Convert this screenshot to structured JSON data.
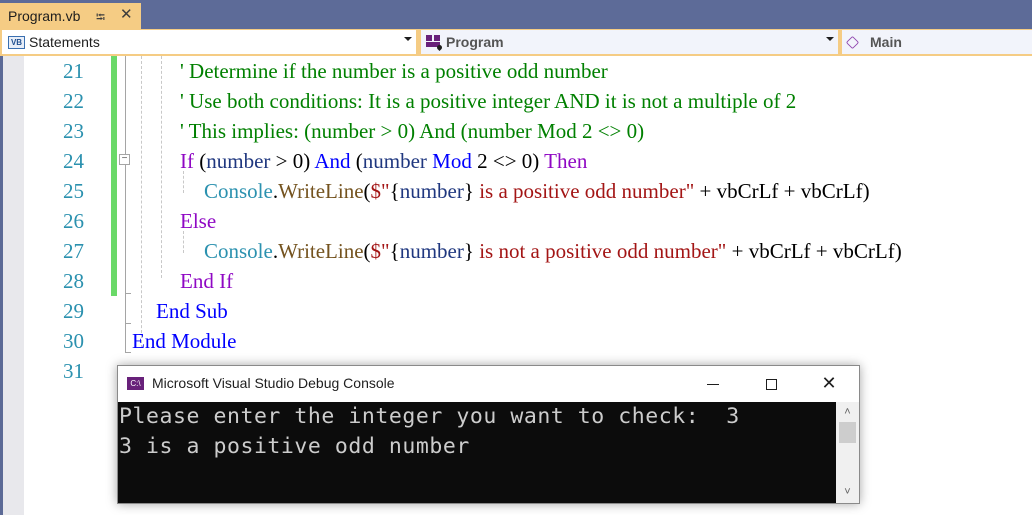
{
  "tab": {
    "title": "Program.vb",
    "pin_icon": "pin-icon",
    "close_icon": "close-icon"
  },
  "navbar": {
    "project_combo": {
      "icon": "vb-project-icon",
      "icon_text": "VB",
      "value": "Statements"
    },
    "type_combo": {
      "icon": "module-icon",
      "value": "Program"
    },
    "member_combo": {
      "icon": "method-icon",
      "value": "Main"
    }
  },
  "editor": {
    "line_numbers": [
      "21",
      "22",
      "23",
      "24",
      "25",
      "26",
      "27",
      "28",
      "29",
      "30",
      "31"
    ],
    "lines": [
      {
        "number": "21",
        "tokens": [
          {
            "t": "cm",
            "v": "' Determine if the number is a positive odd number"
          }
        ]
      },
      {
        "number": "22",
        "tokens": [
          {
            "t": "cm",
            "v": "' Use both conditions: It is a positive integer AND it is not a multiple of 2"
          }
        ]
      },
      {
        "number": "23",
        "tokens": [
          {
            "t": "cm",
            "v": "' This implies: (number > 0) And (number Mod 2 <> 0)"
          }
        ]
      },
      {
        "number": "24",
        "tokens": [
          {
            "t": "ctl",
            "v": "If"
          },
          {
            "t": "pl",
            "v": " ("
          },
          {
            "t": "id",
            "v": "number"
          },
          {
            "t": "pl",
            "v": " > 0) "
          },
          {
            "t": "kw",
            "v": "And"
          },
          {
            "t": "pl",
            "v": " ("
          },
          {
            "t": "id",
            "v": "number"
          },
          {
            "t": "pl",
            "v": " "
          },
          {
            "t": "kw",
            "v": "Mod"
          },
          {
            "t": "pl",
            "v": " 2 <> 0) "
          },
          {
            "t": "ctl",
            "v": "Then"
          }
        ]
      },
      {
        "number": "25",
        "tokens": [
          {
            "t": "ty",
            "v": "Console"
          },
          {
            "t": "pl",
            "v": "."
          },
          {
            "t": "fn",
            "v": "WriteLine"
          },
          {
            "t": "pl",
            "v": "("
          },
          {
            "t": "st",
            "v": "$\""
          },
          {
            "t": "pl",
            "v": "{"
          },
          {
            "t": "id",
            "v": "number"
          },
          {
            "t": "pl",
            "v": "}"
          },
          {
            "t": "st",
            "v": " is a positive odd number\""
          },
          {
            "t": "pl",
            "v": " + vbCrLf + vbCrLf)"
          }
        ]
      },
      {
        "number": "26",
        "tokens": [
          {
            "t": "ctl",
            "v": "Else"
          }
        ]
      },
      {
        "number": "27",
        "tokens": [
          {
            "t": "ty",
            "v": "Console"
          },
          {
            "t": "pl",
            "v": "."
          },
          {
            "t": "fn",
            "v": "WriteLine"
          },
          {
            "t": "pl",
            "v": "("
          },
          {
            "t": "st",
            "v": "$\""
          },
          {
            "t": "pl",
            "v": "{"
          },
          {
            "t": "id",
            "v": "number"
          },
          {
            "t": "pl",
            "v": "}"
          },
          {
            "t": "st",
            "v": " is not a positive odd number\""
          },
          {
            "t": "pl",
            "v": " + vbCrLf + vbCrLf)"
          }
        ]
      },
      {
        "number": "28",
        "tokens": [
          {
            "t": "ctl",
            "v": "End If"
          }
        ]
      },
      {
        "number": "29",
        "tokens": [
          {
            "t": "kw",
            "v": "End Sub"
          }
        ]
      },
      {
        "number": "30",
        "tokens": [
          {
            "t": "kw",
            "v": "End Module"
          }
        ]
      },
      {
        "number": "31",
        "tokens": []
      }
    ],
    "colors": {
      "keyword": "#0000ff",
      "control": "#8f08c4",
      "comment": "#008000",
      "string": "#a31515",
      "type": "#2b91af",
      "method": "#74531f",
      "identifier": "#1f377f",
      "line_number": "#2b91af",
      "change_bar": "#6ad968"
    }
  },
  "console": {
    "icon": "console-app-icon",
    "icon_text": "C:\\",
    "title": "Microsoft Visual Studio Debug Console",
    "minimize_icon": "minimize-icon",
    "maximize_icon": "maximize-icon",
    "close_icon": "close-icon",
    "output_lines": [
      "Please enter the integer you want to check:  3",
      "3 is a positive odd number"
    ]
  }
}
